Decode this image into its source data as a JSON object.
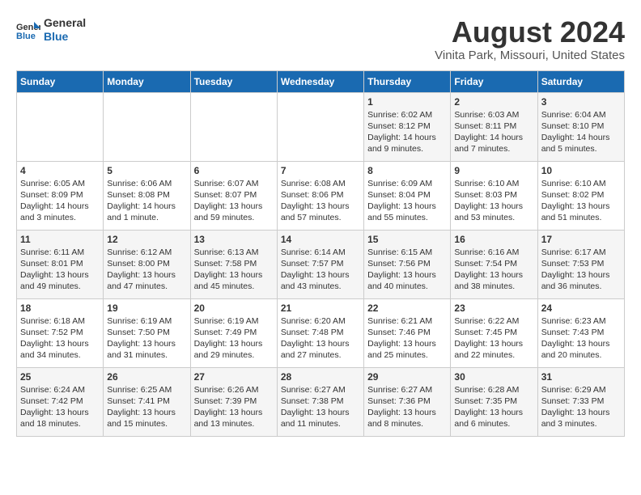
{
  "logo": {
    "line1": "General",
    "line2": "Blue"
  },
  "title": "August 2024",
  "subtitle": "Vinita Park, Missouri, United States",
  "weekdays": [
    "Sunday",
    "Monday",
    "Tuesday",
    "Wednesday",
    "Thursday",
    "Friday",
    "Saturday"
  ],
  "weeks": [
    [
      {
        "day": "",
        "info": ""
      },
      {
        "day": "",
        "info": ""
      },
      {
        "day": "",
        "info": ""
      },
      {
        "day": "",
        "info": ""
      },
      {
        "day": "1",
        "info": "Sunrise: 6:02 AM\nSunset: 8:12 PM\nDaylight: 14 hours\nand 9 minutes."
      },
      {
        "day": "2",
        "info": "Sunrise: 6:03 AM\nSunset: 8:11 PM\nDaylight: 14 hours\nand 7 minutes."
      },
      {
        "day": "3",
        "info": "Sunrise: 6:04 AM\nSunset: 8:10 PM\nDaylight: 14 hours\nand 5 minutes."
      }
    ],
    [
      {
        "day": "4",
        "info": "Sunrise: 6:05 AM\nSunset: 8:09 PM\nDaylight: 14 hours\nand 3 minutes."
      },
      {
        "day": "5",
        "info": "Sunrise: 6:06 AM\nSunset: 8:08 PM\nDaylight: 14 hours\nand 1 minute."
      },
      {
        "day": "6",
        "info": "Sunrise: 6:07 AM\nSunset: 8:07 PM\nDaylight: 13 hours\nand 59 minutes."
      },
      {
        "day": "7",
        "info": "Sunrise: 6:08 AM\nSunset: 8:06 PM\nDaylight: 13 hours\nand 57 minutes."
      },
      {
        "day": "8",
        "info": "Sunrise: 6:09 AM\nSunset: 8:04 PM\nDaylight: 13 hours\nand 55 minutes."
      },
      {
        "day": "9",
        "info": "Sunrise: 6:10 AM\nSunset: 8:03 PM\nDaylight: 13 hours\nand 53 minutes."
      },
      {
        "day": "10",
        "info": "Sunrise: 6:10 AM\nSunset: 8:02 PM\nDaylight: 13 hours\nand 51 minutes."
      }
    ],
    [
      {
        "day": "11",
        "info": "Sunrise: 6:11 AM\nSunset: 8:01 PM\nDaylight: 13 hours\nand 49 minutes."
      },
      {
        "day": "12",
        "info": "Sunrise: 6:12 AM\nSunset: 8:00 PM\nDaylight: 13 hours\nand 47 minutes."
      },
      {
        "day": "13",
        "info": "Sunrise: 6:13 AM\nSunset: 7:58 PM\nDaylight: 13 hours\nand 45 minutes."
      },
      {
        "day": "14",
        "info": "Sunrise: 6:14 AM\nSunset: 7:57 PM\nDaylight: 13 hours\nand 43 minutes."
      },
      {
        "day": "15",
        "info": "Sunrise: 6:15 AM\nSunset: 7:56 PM\nDaylight: 13 hours\nand 40 minutes."
      },
      {
        "day": "16",
        "info": "Sunrise: 6:16 AM\nSunset: 7:54 PM\nDaylight: 13 hours\nand 38 minutes."
      },
      {
        "day": "17",
        "info": "Sunrise: 6:17 AM\nSunset: 7:53 PM\nDaylight: 13 hours\nand 36 minutes."
      }
    ],
    [
      {
        "day": "18",
        "info": "Sunrise: 6:18 AM\nSunset: 7:52 PM\nDaylight: 13 hours\nand 34 minutes."
      },
      {
        "day": "19",
        "info": "Sunrise: 6:19 AM\nSunset: 7:50 PM\nDaylight: 13 hours\nand 31 minutes."
      },
      {
        "day": "20",
        "info": "Sunrise: 6:19 AM\nSunset: 7:49 PM\nDaylight: 13 hours\nand 29 minutes."
      },
      {
        "day": "21",
        "info": "Sunrise: 6:20 AM\nSunset: 7:48 PM\nDaylight: 13 hours\nand 27 minutes."
      },
      {
        "day": "22",
        "info": "Sunrise: 6:21 AM\nSunset: 7:46 PM\nDaylight: 13 hours\nand 25 minutes."
      },
      {
        "day": "23",
        "info": "Sunrise: 6:22 AM\nSunset: 7:45 PM\nDaylight: 13 hours\nand 22 minutes."
      },
      {
        "day": "24",
        "info": "Sunrise: 6:23 AM\nSunset: 7:43 PM\nDaylight: 13 hours\nand 20 minutes."
      }
    ],
    [
      {
        "day": "25",
        "info": "Sunrise: 6:24 AM\nSunset: 7:42 PM\nDaylight: 13 hours\nand 18 minutes."
      },
      {
        "day": "26",
        "info": "Sunrise: 6:25 AM\nSunset: 7:41 PM\nDaylight: 13 hours\nand 15 minutes."
      },
      {
        "day": "27",
        "info": "Sunrise: 6:26 AM\nSunset: 7:39 PM\nDaylight: 13 hours\nand 13 minutes."
      },
      {
        "day": "28",
        "info": "Sunrise: 6:27 AM\nSunset: 7:38 PM\nDaylight: 13 hours\nand 11 minutes."
      },
      {
        "day": "29",
        "info": "Sunrise: 6:27 AM\nSunset: 7:36 PM\nDaylight: 13 hours\nand 8 minutes."
      },
      {
        "day": "30",
        "info": "Sunrise: 6:28 AM\nSunset: 7:35 PM\nDaylight: 13 hours\nand 6 minutes."
      },
      {
        "day": "31",
        "info": "Sunrise: 6:29 AM\nSunset: 7:33 PM\nDaylight: 13 hours\nand 3 minutes."
      }
    ]
  ]
}
